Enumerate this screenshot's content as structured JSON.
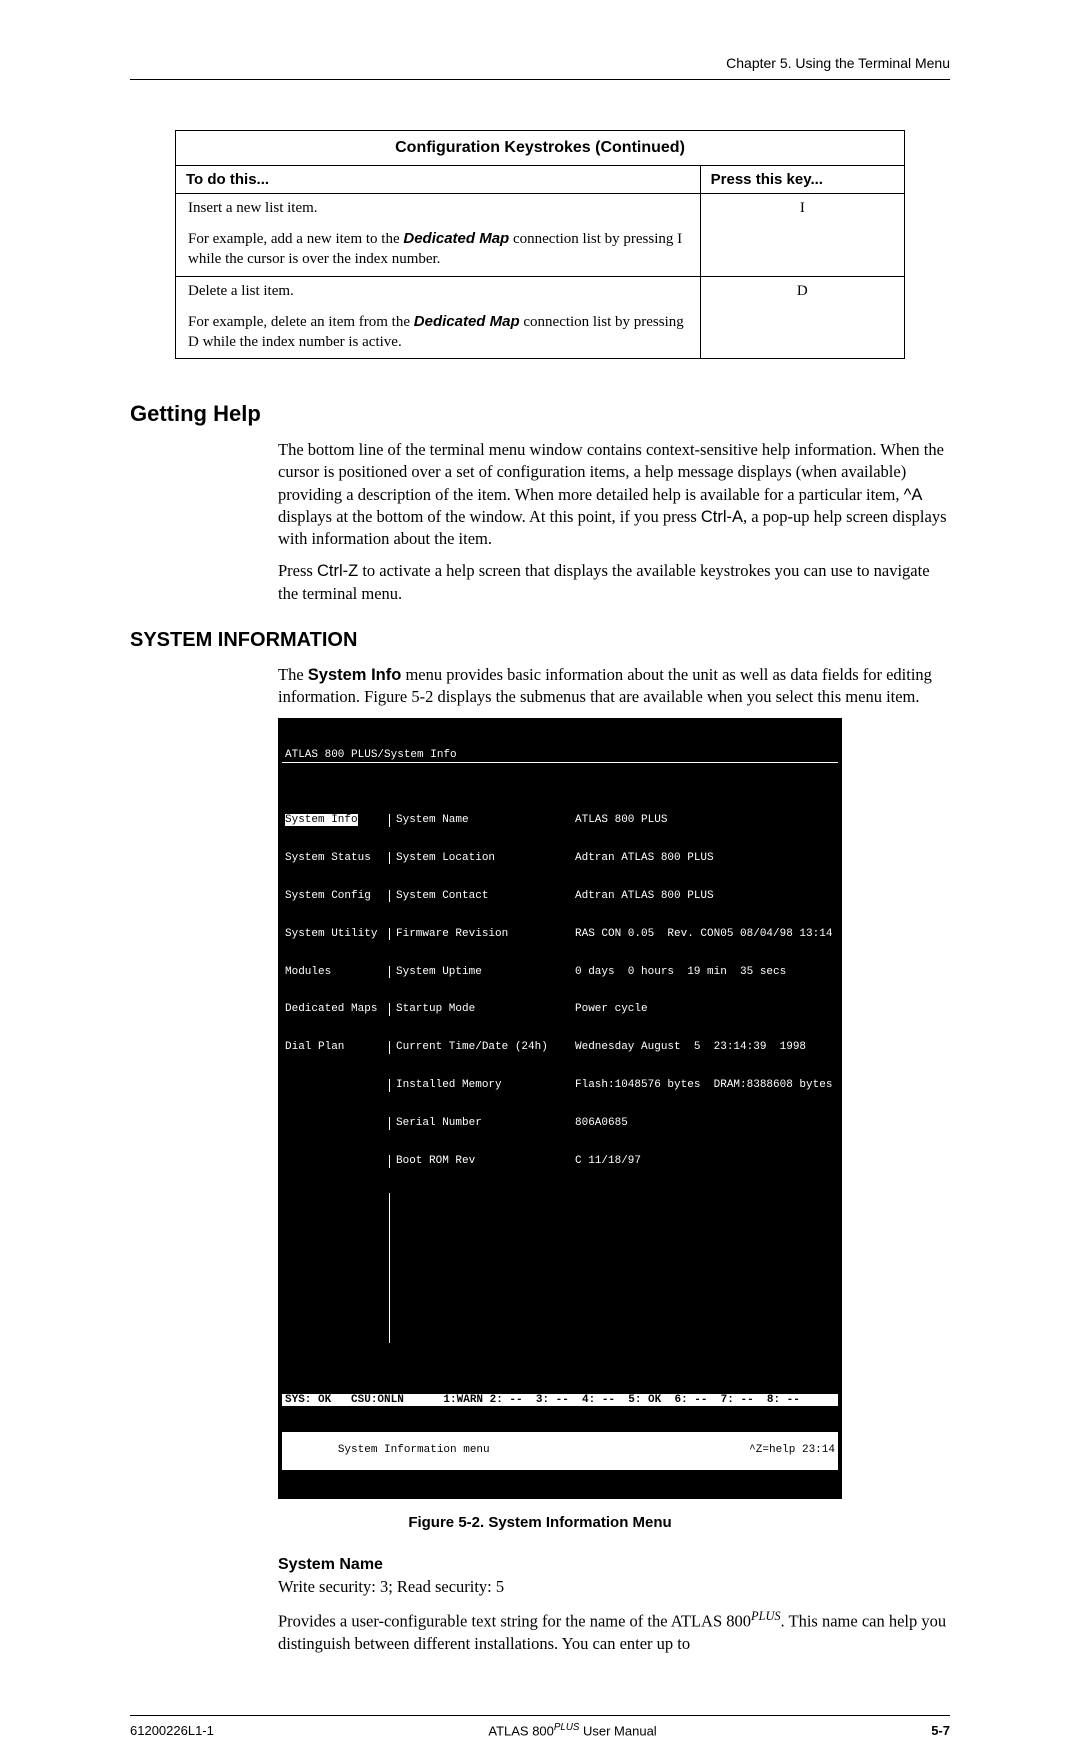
{
  "header": {
    "chapter": "Chapter 5.  Using the Terminal Menu"
  },
  "table": {
    "title": "Configuration Keystrokes (Continued)",
    "col1": "To do this...",
    "col2": "Press this key...",
    "rows": [
      {
        "action": "Insert a new list item.",
        "key": "I",
        "example_pre": "For example, add a new item to the ",
        "example_bold": "Dedicated Map",
        "example_post": " connection list by pressing I while the cursor is over the index number."
      },
      {
        "action": "Delete a list item.",
        "key": "D",
        "example_pre": "For example, delete an item from the ",
        "example_bold": "Dedicated Map",
        "example_post": " connection list by pressing D while the index number is active."
      }
    ]
  },
  "help": {
    "heading": "Getting Help",
    "p1a": "The bottom line of the terminal menu window contains context-sensitive help information.  When the cursor is positioned over a set of configuration items, a help message displays (when available) providing a description of the item. When more detailed help is available for a particular item, ",
    "p1b": "^A",
    "p1c": " displays at the bottom of the window.  At this point, if you press ",
    "p1d": "Ctrl-A",
    "p1e": ", a pop-up help screen displays with information about the item.",
    "p2a": "Press ",
    "p2b": "Ctrl-Z",
    "p2c": " to activate a help screen that displays the available keystrokes you can use to navigate the terminal menu."
  },
  "sysinfo": {
    "heading": "SYSTEM INFORMATION",
    "p1a": "The ",
    "p1b": "System Info",
    "p1c": " menu provides basic information about the unit as well as data fields for editing information. Figure 5-2 displays the submenus that are available when you select this menu item."
  },
  "terminal": {
    "title": "ATLAS 800 PLUS/System Info",
    "menu": [
      "System Info",
      "System Status",
      "System Config",
      "System Utility",
      "Modules",
      "Dedicated Maps",
      "Dial Plan"
    ],
    "fields": [
      [
        "System Name",
        "ATLAS 800 PLUS"
      ],
      [
        "System Location",
        "Adtran ATLAS 800 PLUS"
      ],
      [
        "System Contact",
        "Adtran ATLAS 800 PLUS"
      ],
      [
        "Firmware Revision",
        "RAS CON 0.05  Rev. CON05 08/04/98 13:14"
      ],
      [
        "System Uptime",
        "0 days  0 hours  19 min  35 secs"
      ],
      [
        "Startup Mode",
        "Power cycle"
      ],
      [
        "Current Time/Date (24h)",
        "Wednesday August  5  23:14:39  1998"
      ],
      [
        "Installed Memory",
        "Flash:1048576 bytes  DRAM:8388608 bytes"
      ],
      [
        "Serial Number",
        "806A0685"
      ],
      [
        "Boot ROM Rev",
        "C 11/18/97"
      ]
    ],
    "status1": "SYS: OK   CSU:ONLN      1:WARN 2: --  3: --  4: --  5: OK  6: --  7: --  8: --",
    "status2_left": "System Information menu",
    "status2_right": "^Z=help 23:14"
  },
  "figure_caption": "Figure 5-2.  System Information Menu",
  "systemname": {
    "heading": "System Name",
    "sec": "Write security: 3; Read security: 5",
    "p_a": "Provides a user-configurable text string for the name of the ATLAS   800",
    "p_sup": "PLUS",
    "p_b": ". This name can help you distinguish between different installations. You can enter up to"
  },
  "footer": {
    "left": "61200226L1-1",
    "mid_a": "ATLAS  800",
    "mid_sup": "PLUS",
    "mid_b": " User Manual",
    "right": "5-7"
  }
}
